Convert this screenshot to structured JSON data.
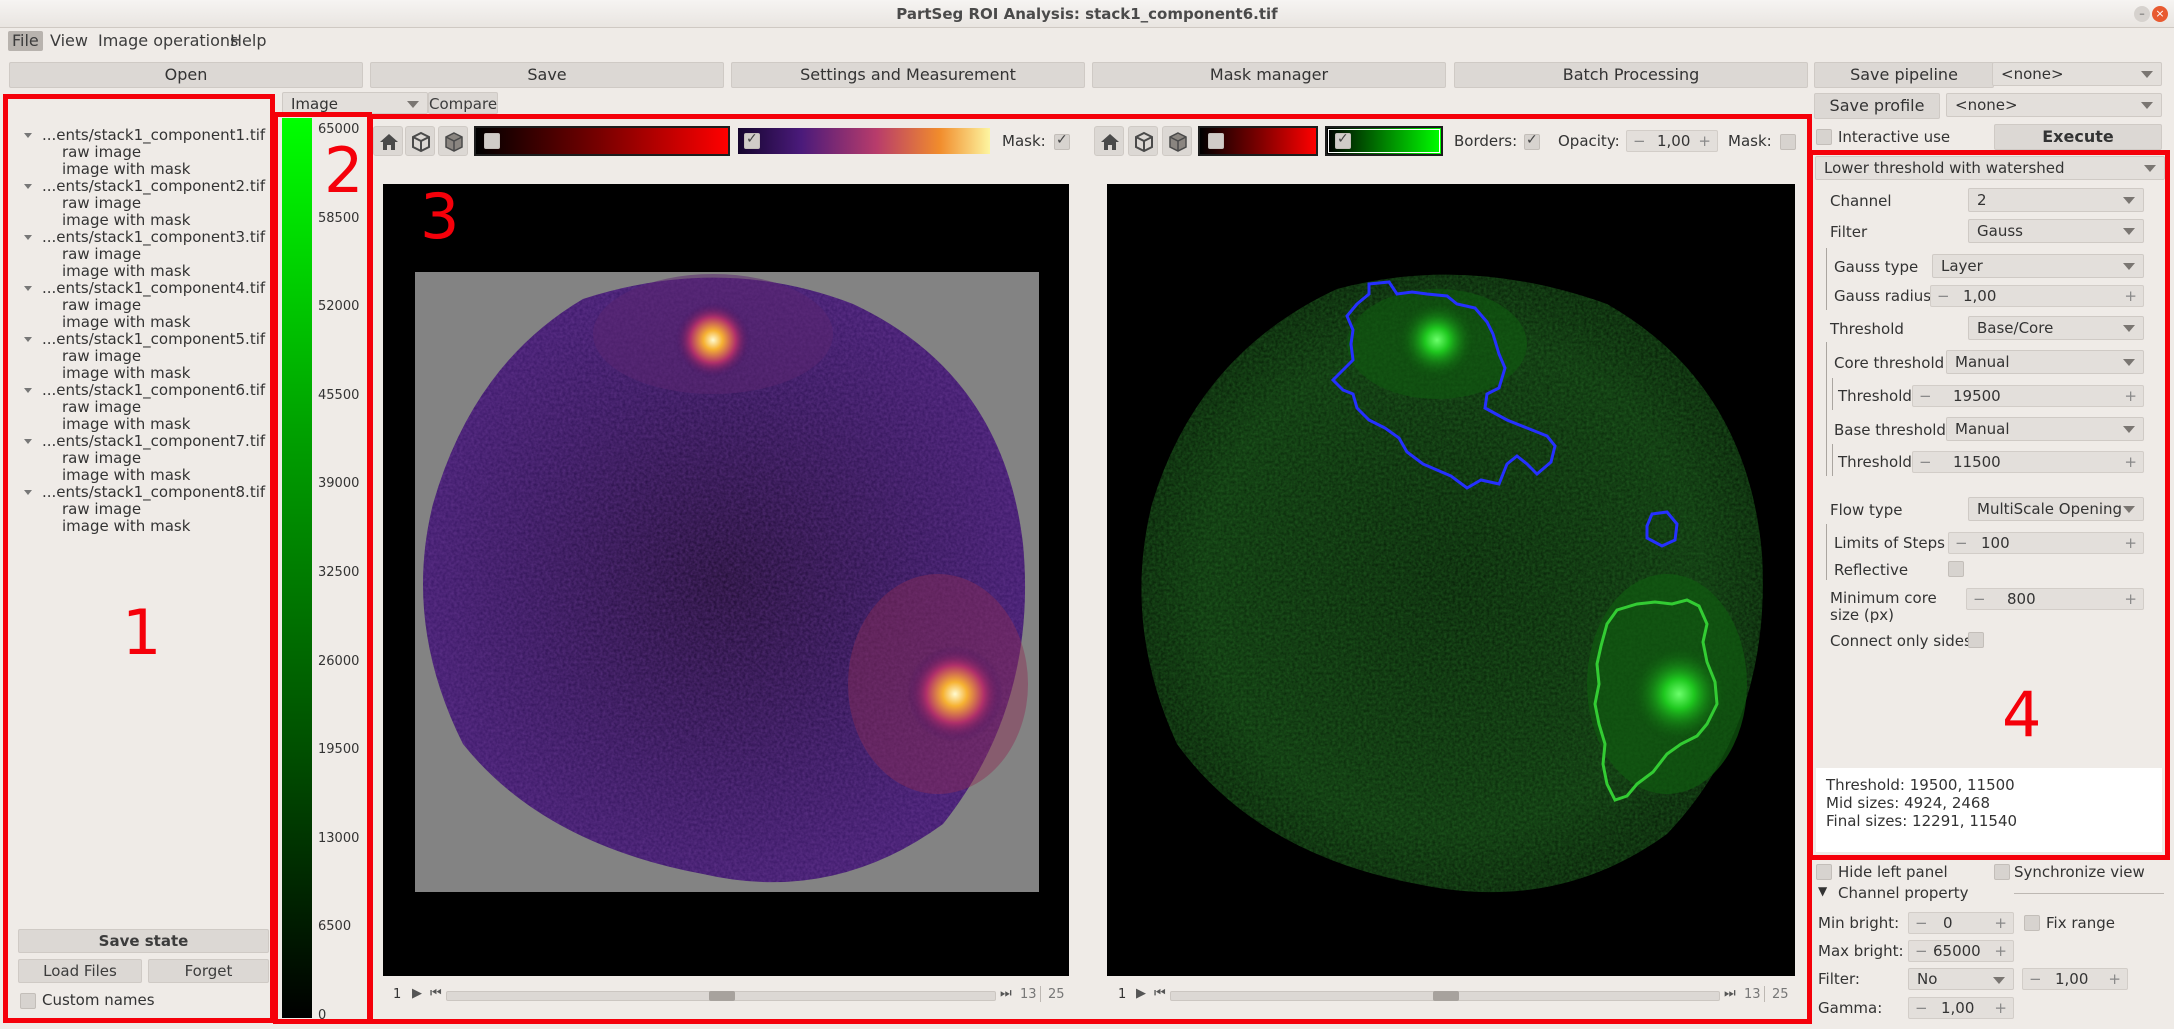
{
  "window": {
    "title": "PartSeg ROI Analysis: stack1_component6.tif"
  },
  "menu": [
    "File",
    "View",
    "Image operations",
    "Help"
  ],
  "toolbar": {
    "open": "Open",
    "save": "Save",
    "settings": "Settings and Measurement",
    "mask_manager": "Mask manager",
    "batch": "Batch Processing",
    "save_pipeline": "Save pipeline",
    "pipeline_value": "<none>",
    "save_profile": "Save profile",
    "profile_value": "<none>",
    "interactive": "Interactive use",
    "execute": "Execute"
  },
  "files": [
    {
      "name": "...ents/stack1_component1.tif",
      "items": [
        "raw image",
        "image with mask"
      ]
    },
    {
      "name": "...ents/stack1_component2.tif",
      "items": [
        "raw image",
        "image with mask"
      ]
    },
    {
      "name": "...ents/stack1_component3.tif",
      "items": [
        "raw image",
        "image with mask"
      ]
    },
    {
      "name": "...ents/stack1_component4.tif",
      "items": [
        "raw image",
        "image with mask"
      ]
    },
    {
      "name": "...ents/stack1_component5.tif",
      "items": [
        "raw image",
        "image with mask"
      ]
    },
    {
      "name": "...ents/stack1_component6.tif",
      "items": [
        "raw image",
        "image with mask"
      ]
    },
    {
      "name": "...ents/stack1_component7.tif",
      "items": [
        "raw image",
        "image with mask"
      ]
    },
    {
      "name": "...ents/stack1_component8.tif",
      "items": [
        "raw image",
        "image with mask"
      ]
    }
  ],
  "left_panel": {
    "save_state": "Save state",
    "load_files": "Load Files",
    "forget": "Forget",
    "custom_names": "Custom names"
  },
  "colorbar": {
    "mode": "Image",
    "compare": "Compare",
    "ticks": [
      "65000",
      "58500",
      "52000",
      "45500",
      "39000",
      "32500",
      "26000",
      "19500",
      "13000",
      "6500",
      "0"
    ]
  },
  "view1": {
    "mask_label": "Mask:",
    "page": "1",
    "current": "13",
    "total": "25",
    "slider_frac": 0.5
  },
  "view2": {
    "borders_label": "Borders:",
    "opacity_label": "Opacity:",
    "opacity": "1,00",
    "mask_label": "Mask:",
    "page": "1",
    "current": "13",
    "total": "25",
    "slider_frac": 0.5
  },
  "algorithm": {
    "name": "Lower threshold with watershed",
    "channel_label": "Channel",
    "channel": "2",
    "filter_label": "Filter",
    "filter": "Gauss",
    "gauss_type_label": "Gauss type",
    "gauss_type": "Layer",
    "gauss_radius_label": "Gauss radius",
    "gauss_radius": "1,00",
    "threshold_label": "Threshold",
    "threshold": "Base/Core",
    "core_threshold_label": "Core threshold",
    "core_threshold": "Manual",
    "core_value_label": "Threshold",
    "core_value": "19500",
    "base_threshold_label": "Base threshold",
    "base_threshold": "Manual",
    "base_value_label": "Threshold",
    "base_value": "11500",
    "flow_type_label": "Flow type",
    "flow_type": "MultiScale Opening",
    "limits_label": "Limits of Steps",
    "limits": "100",
    "reflective_label": "Reflective",
    "min_core_label_1": "Minimum core",
    "min_core_label_2": "size (px)",
    "min_core": "800",
    "connect_label": "Connect only sides",
    "info": [
      "Threshold: 19500, 11500",
      "Mid sizes: 4924, 2468",
      "Final sizes: 12291, 11540"
    ]
  },
  "bottom_right": {
    "hide_left": "Hide left panel",
    "sync": "Synchronize view",
    "channel_property": "Channel property",
    "min_bright_label": "Min bright:",
    "min_bright": "0",
    "fix_range": "Fix range",
    "max_bright_label": "Max bright:",
    "max_bright": "65000",
    "filter_label": "Filter:",
    "filter": "No",
    "filter_value": "1,00",
    "gamma_label": "Gamma:",
    "gamma": "1,00"
  },
  "annotations": [
    "1",
    "2",
    "3",
    "4"
  ],
  "colors": {
    "accent_red": "#f5000a",
    "colorbar_green": "#00ff00",
    "mask_blue": "#1a2cff"
  }
}
